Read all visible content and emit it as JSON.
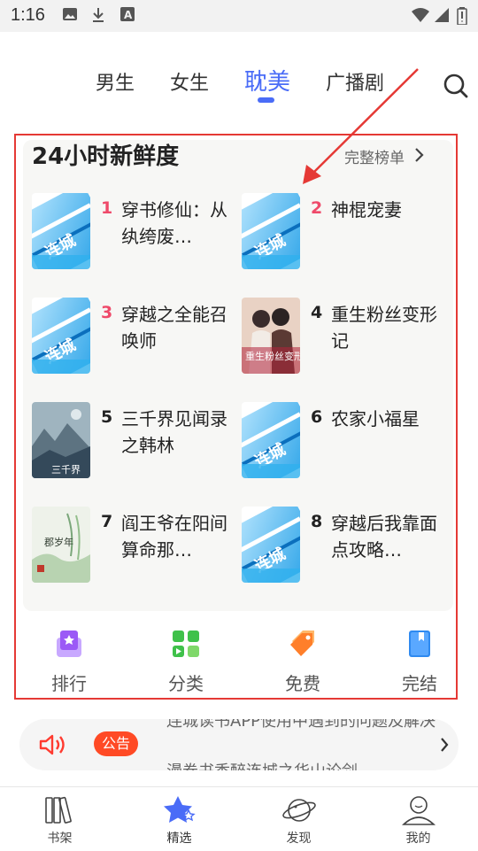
{
  "status_bar": {
    "time": "1:16"
  },
  "tabs": [
    {
      "label": "男生"
    },
    {
      "label": "女生"
    },
    {
      "label": "耽美"
    },
    {
      "label": "广播剧"
    }
  ],
  "ranking": {
    "title": "24小时新鲜度",
    "full_list_label": "完整榜单",
    "books": [
      {
        "rank": "1",
        "title": "穿书修仙：从纨绔废…",
        "cover": "default"
      },
      {
        "rank": "2",
        "title": "神棍宠妻",
        "cover": "default"
      },
      {
        "rank": "3",
        "title": "穿越之全能召唤师",
        "cover": "default"
      },
      {
        "rank": "4",
        "title": "重生粉丝变形记",
        "cover": "illustrated",
        "cover_text": "重生粉丝变形记"
      },
      {
        "rank": "5",
        "title": "三千界见闻录之韩林",
        "cover": "landscape",
        "cover_text": "三千界"
      },
      {
        "rank": "6",
        "title": "农家小福星",
        "cover": "default"
      },
      {
        "rank": "7",
        "title": "阎王爷在阳间算命那…",
        "cover": "watercolor",
        "cover_text": "郡岁年"
      },
      {
        "rank": "8",
        "title": "穿越后我靠面点攻略…",
        "cover": "default"
      }
    ]
  },
  "shortcuts": [
    {
      "label": "排行",
      "icon": "ranking-icon"
    },
    {
      "label": "分类",
      "icon": "category-icon"
    },
    {
      "label": "免费",
      "icon": "free-tag-icon"
    },
    {
      "label": "完结",
      "icon": "finished-book-icon"
    }
  ],
  "notice": {
    "badge": "公告",
    "line1": "连城读书APP使用中遇到的问题及解决",
    "line2": "漫卷书香醉连城之华山论剑"
  },
  "bottom_nav": [
    {
      "label": "书架",
      "icon": "bookshelf-icon"
    },
    {
      "label": "精选",
      "icon": "star-icon"
    },
    {
      "label": "发现",
      "icon": "planet-icon"
    },
    {
      "label": "我的",
      "icon": "profile-icon"
    }
  ],
  "colors": {
    "accent": "#4a6cf7",
    "rank_highlight": "#ef4a6a",
    "rank_normal": "#222222",
    "annotation_red": "#e53935",
    "badge": "#ff4a25"
  }
}
